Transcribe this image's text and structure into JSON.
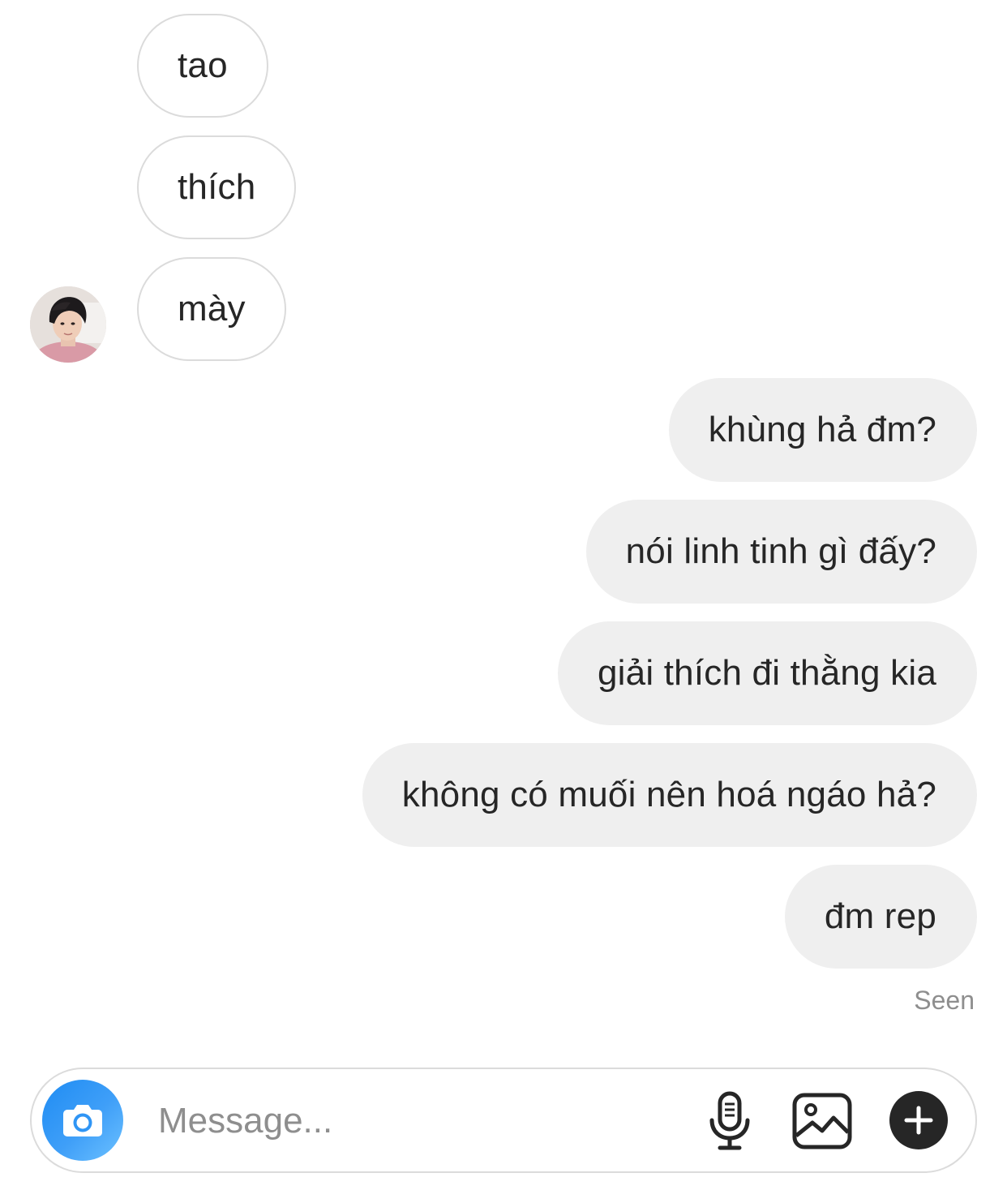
{
  "thread": {
    "incoming": [
      {
        "text": "tao"
      },
      {
        "text": "thích"
      },
      {
        "text": "mày"
      }
    ],
    "outgoing": [
      {
        "text": "khùng hả đm?"
      },
      {
        "text": "nói linh tinh gì đấy?"
      },
      {
        "text": "giải thích đi thằng kia"
      },
      {
        "text": "không có muối nên hoá ngáo hả?"
      },
      {
        "text": "đm rep"
      }
    ],
    "seen_label": "Seen"
  },
  "composer": {
    "placeholder": "Message...",
    "camera_icon": "camera-icon",
    "mic_icon": "microphone-icon",
    "gallery_icon": "gallery-icon",
    "plus_icon": "plus-icon",
    "camera_color": "#3897f0"
  },
  "colors": {
    "outgoing_bubble": "#efefef",
    "incoming_border": "#dbdbdb",
    "text": "#262626",
    "muted": "#8e8e8e"
  }
}
